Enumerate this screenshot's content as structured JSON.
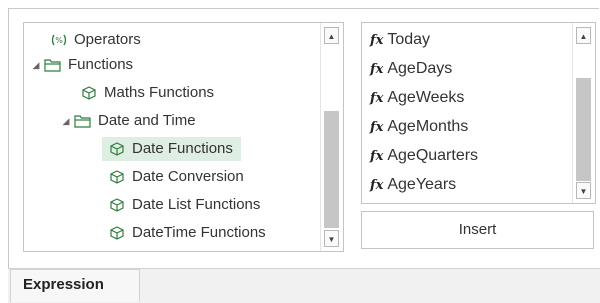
{
  "tree": {
    "items": [
      {
        "label": "Operators",
        "icon": "operators-icon"
      },
      {
        "label": "Functions",
        "icon": "folder-icon",
        "expanded": true
      },
      {
        "label": "Maths Functions",
        "icon": "cube-icon"
      },
      {
        "label": "Date and Time",
        "icon": "folder-icon",
        "expanded": true
      },
      {
        "label": "Date Functions",
        "icon": "cube-icon",
        "selected": true
      },
      {
        "label": "Date Conversion",
        "icon": "cube-icon"
      },
      {
        "label": "Date List Functions",
        "icon": "cube-icon"
      },
      {
        "label": "DateTime Functions",
        "icon": "cube-icon"
      }
    ]
  },
  "functions": {
    "fx_symbol": "fx",
    "items": [
      "Today",
      "AgeDays",
      "AgeWeeks",
      "AgeMonths",
      "AgeQuarters",
      "AgeYears"
    ]
  },
  "insert_label": "Insert",
  "tabs": {
    "expression": "Expression"
  },
  "colors": {
    "selected_row": "#dfeee2",
    "icon_green": "#2f7d3c"
  }
}
